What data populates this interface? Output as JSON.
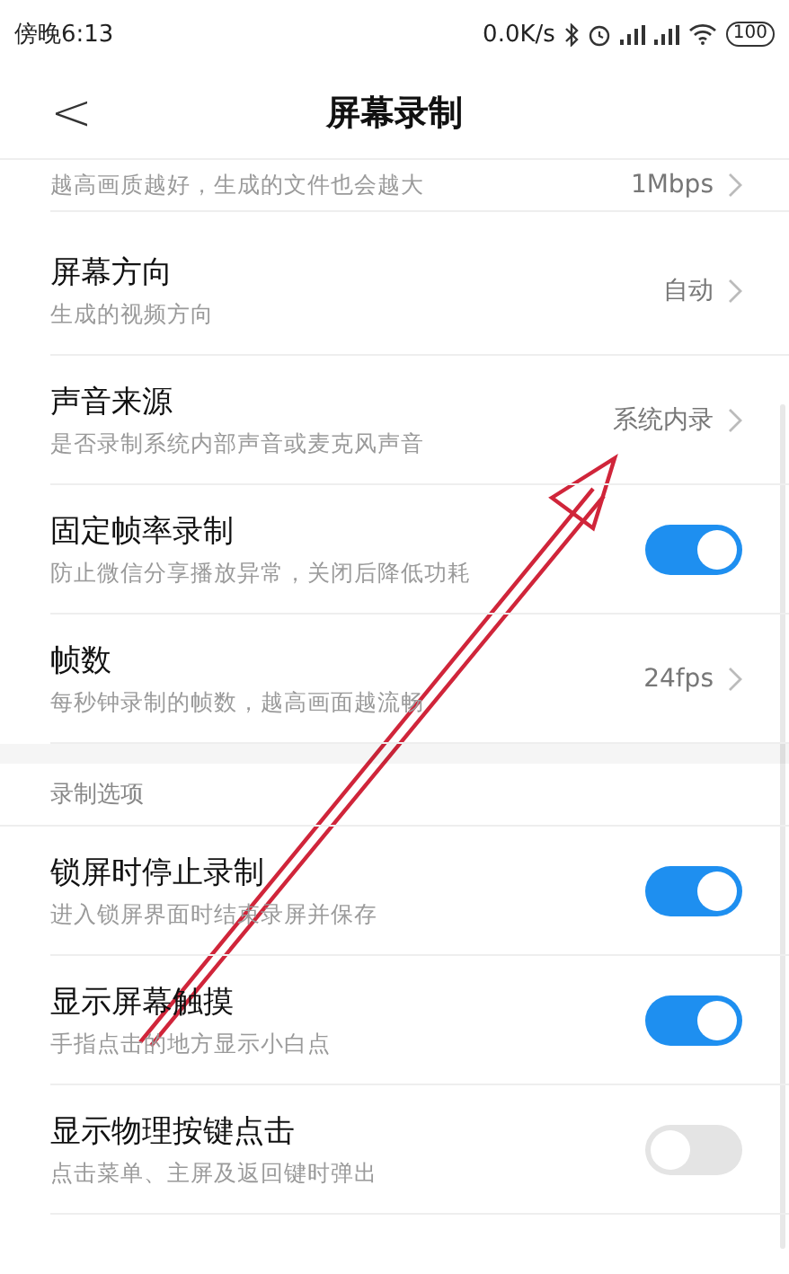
{
  "status_bar": {
    "time": "傍晚6:13",
    "speed": "0.0K/s",
    "battery": "100"
  },
  "header": {
    "back": "<",
    "title": "屏幕录制"
  },
  "sections": [
    {
      "items": [
        {
          "kind": "value",
          "subtitle": "越高画质越好，生成的文件也会越大",
          "value": "1Mbps",
          "partial": true
        },
        {
          "kind": "value",
          "title": "屏幕方向",
          "subtitle": "生成的视频方向",
          "value": "自动"
        },
        {
          "kind": "value",
          "title": "声音来源",
          "subtitle": "是否录制系统内部声音或麦克风声音",
          "value": "系统内录"
        },
        {
          "kind": "toggle",
          "title": "固定帧率录制",
          "subtitle": "防止微信分享播放异常，关闭后降低功耗",
          "on": true
        },
        {
          "kind": "value",
          "title": "帧数",
          "subtitle": "每秒钟录制的帧数，越高画面越流畅",
          "value": "24fps"
        }
      ]
    },
    {
      "header": "录制选项",
      "items": [
        {
          "kind": "toggle",
          "title": "锁屏时停止录制",
          "subtitle": "进入锁屏界面时结束录屏并保存",
          "on": true
        },
        {
          "kind": "toggle",
          "title": "显示屏幕触摸",
          "subtitle": "手指点击的地方显示小白点",
          "on": true
        },
        {
          "kind": "toggle",
          "title": "显示物理按键点击",
          "subtitle": "点击菜单、主屏及返回键时弹出",
          "on": false
        }
      ]
    }
  ]
}
